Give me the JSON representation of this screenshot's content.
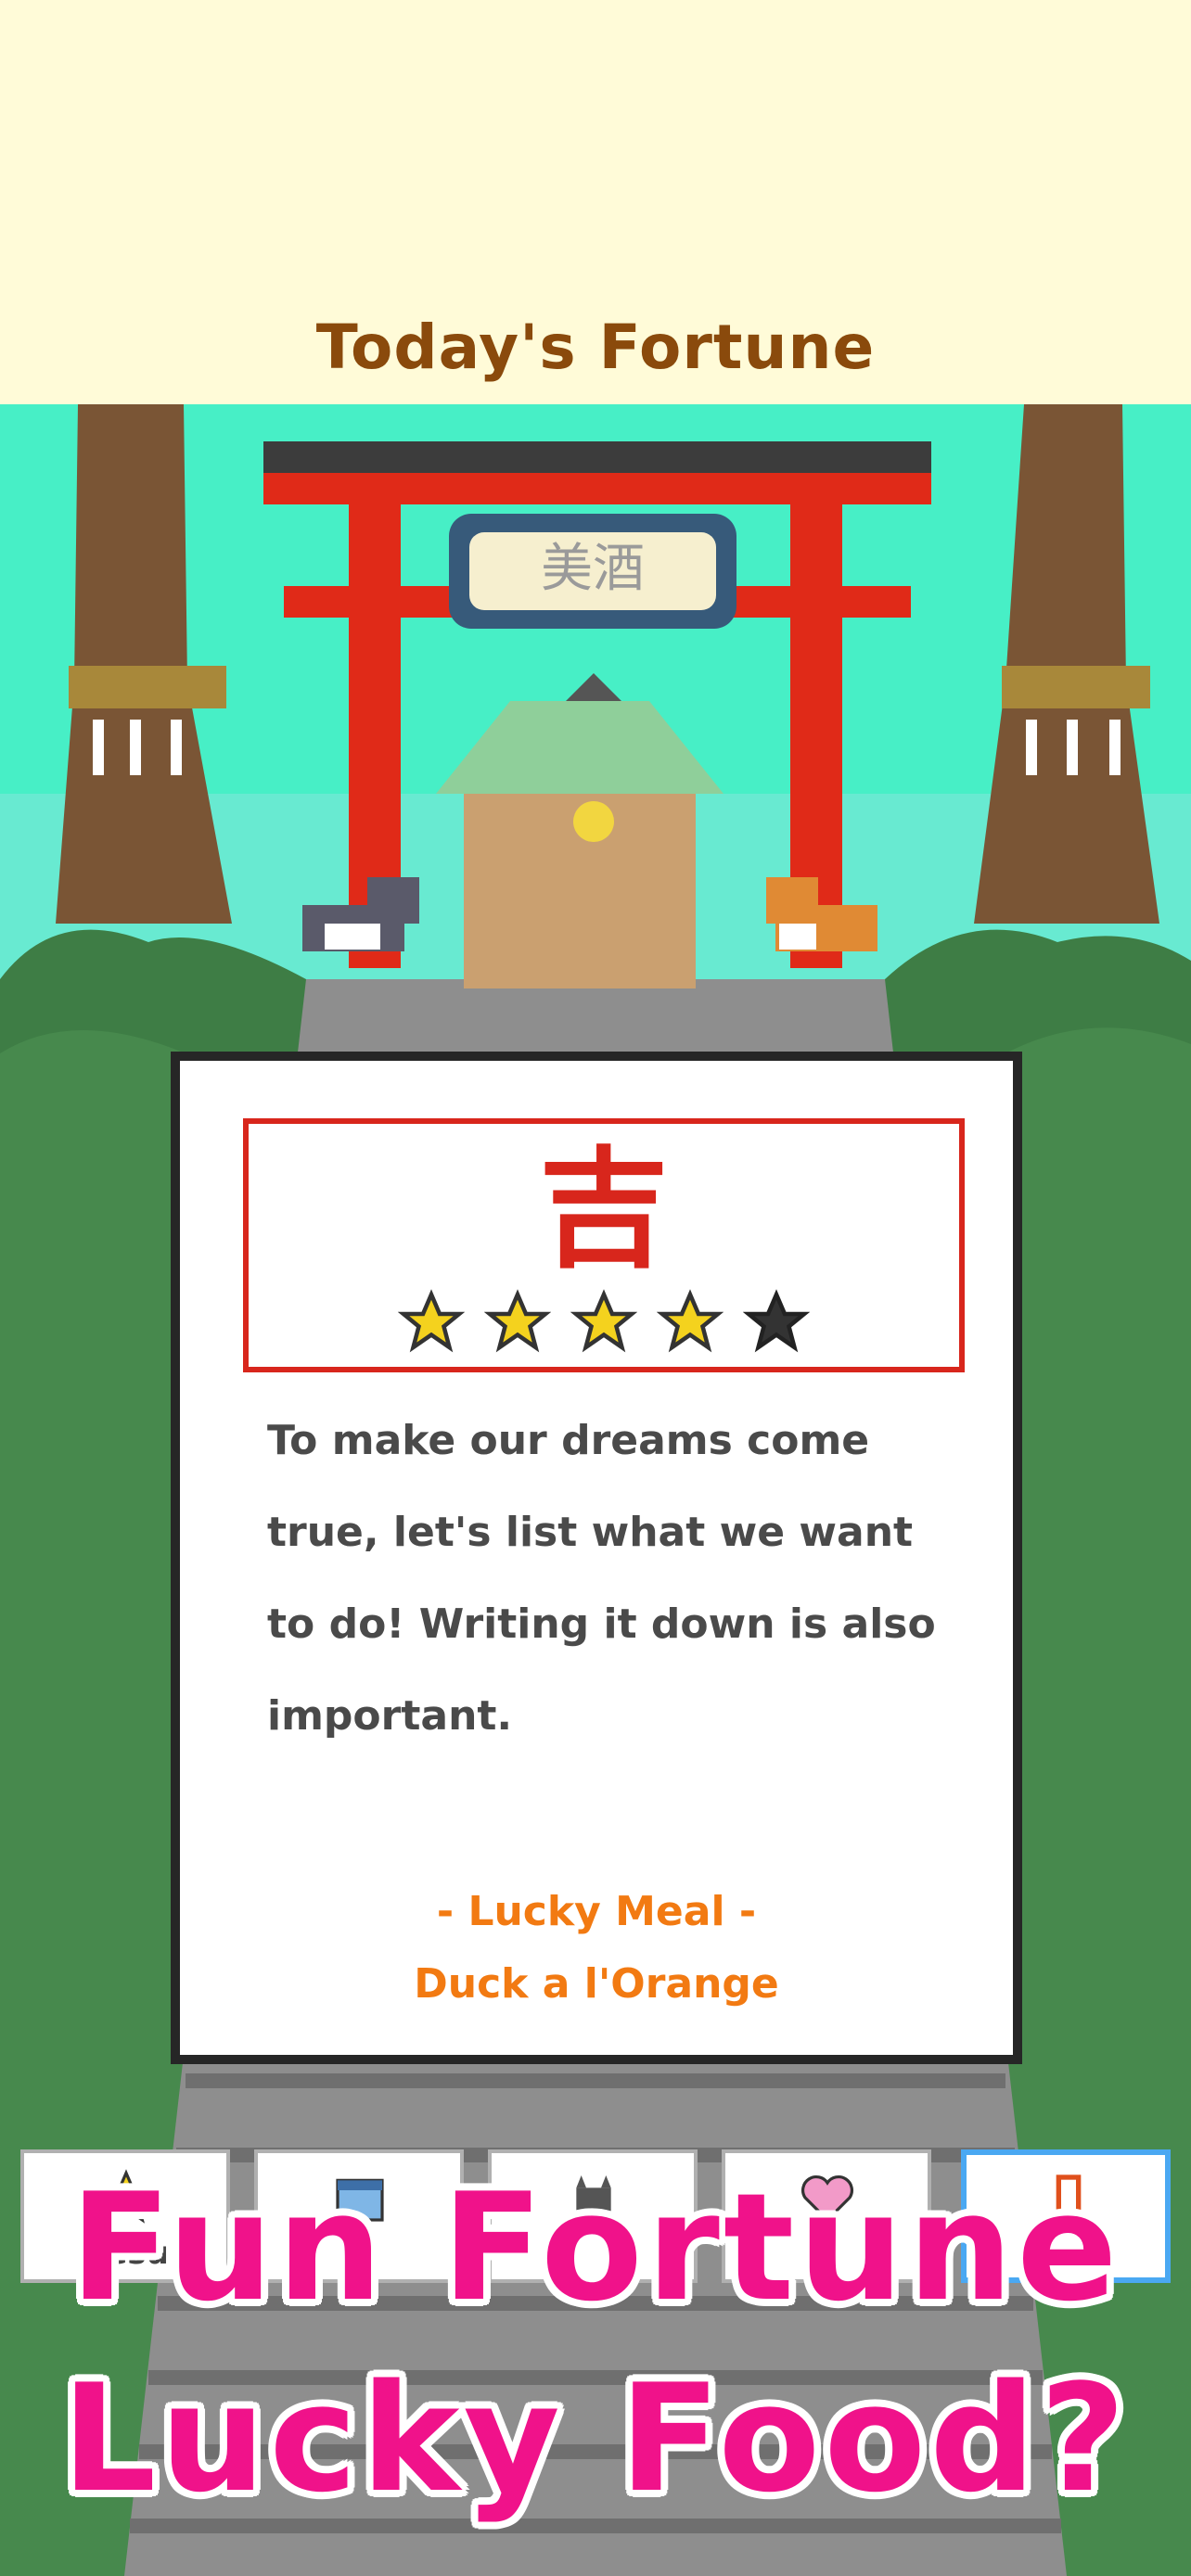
{
  "header": {
    "title": "Today's Fortune"
  },
  "shrine": {
    "plaque_text": "美酒"
  },
  "fortune": {
    "rank": "吉",
    "rating": 4,
    "rating_max": 5,
    "message": "To make our dreams come true, let's list what we want to do! Writing it down is also important.",
    "lucky_label": "- Lucky Meal -",
    "lucky_food": "Duck a l'Orange"
  },
  "tabs": [
    {
      "label": "Resu",
      "icon": "star-icon"
    },
    {
      "label": "",
      "icon": "calendar-icon"
    },
    {
      "label": "",
      "icon": "cat-icon"
    },
    {
      "label": "",
      "icon": "heart-icon"
    },
    {
      "label": "rtune",
      "icon": "omikuji-icon",
      "active": true
    }
  ],
  "promo": {
    "line1": "Fun Fortune",
    "line2": "Lucky Food?"
  },
  "colors": {
    "accent_red": "#d8261c",
    "lucky_orange": "#f27a12",
    "promo_pink": "#f0128a",
    "title_brown": "#8a4a0c"
  }
}
